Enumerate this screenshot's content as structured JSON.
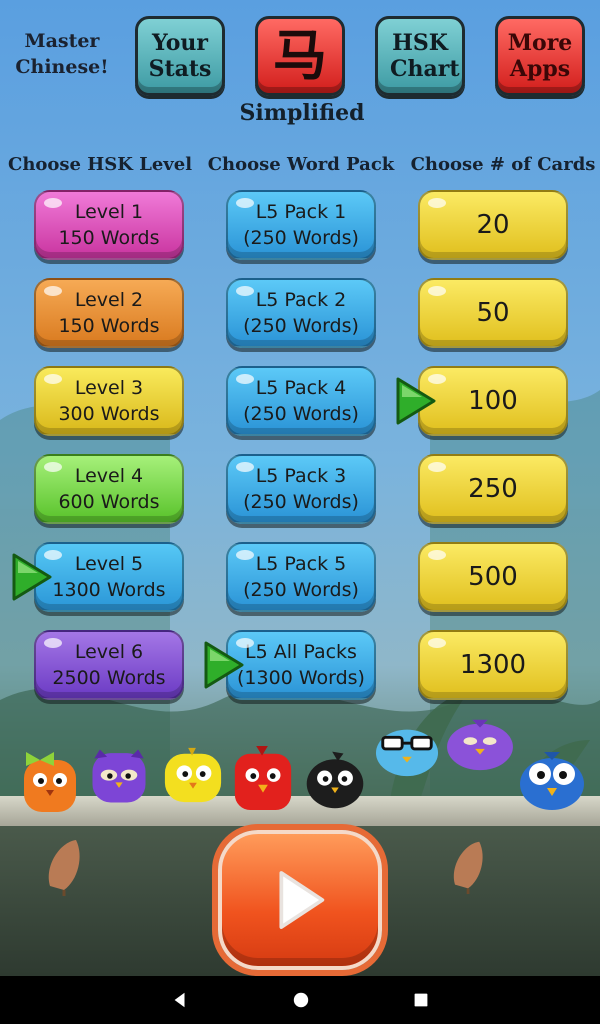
{
  "header": {
    "app_title": "Master Chinese!",
    "stats_label": "Your Stats",
    "char_button": "马",
    "hsk_chart_label": "HSK Chart",
    "more_apps_label": "More Apps",
    "script_mode": "Simplified"
  },
  "columns": {
    "levels_header": "Choose HSK Level",
    "packs_header": "Choose Word Pack",
    "cards_header": "Choose # of Cards"
  },
  "levels": [
    {
      "name": "Level 1",
      "words": "150 Words",
      "color": "#d94fba"
    },
    {
      "name": "Level 2",
      "words": "150 Words",
      "color": "#e8902f"
    },
    {
      "name": "Level 3",
      "words": "300 Words",
      "color": "#ecd32a"
    },
    {
      "name": "Level 4",
      "words": "600 Words",
      "color": "#72d43d"
    },
    {
      "name": "Level 5",
      "words": "1300 Words",
      "color": "#3aa9e3",
      "selected": true
    },
    {
      "name": "Level 6",
      "words": "2500 Words",
      "color": "#8552d3"
    }
  ],
  "packs": [
    {
      "name": "L5 Pack 1",
      "words": "(250 Words)"
    },
    {
      "name": "L5 Pack 2",
      "words": "(250 Words)"
    },
    {
      "name": "L5 Pack 4",
      "words": "(250 Words)"
    },
    {
      "name": "L5 Pack 3",
      "words": "(250 Words)"
    },
    {
      "name": "L5 Pack 5",
      "words": "(250 Words)"
    },
    {
      "name": "L5 All Packs",
      "words": "(1300 Words)",
      "selected": true
    }
  ],
  "cards": [
    {
      "count": "20"
    },
    {
      "count": "50"
    },
    {
      "count": "100",
      "selected": true
    },
    {
      "count": "250"
    },
    {
      "count": "500"
    },
    {
      "count": "1300"
    }
  ],
  "icons": {
    "selection_marker": "green-triangle-arrow-icon",
    "play": "play-icon",
    "nav_back": "back-icon",
    "nav_home": "home-icon",
    "nav_recents": "recents-icon"
  },
  "colors": {
    "top_button_teal": "#3d9aa3",
    "top_button_red": "#d21e1c",
    "pack_blue": "#2a93d6",
    "card_yellow": "#e0bf1d",
    "play_orange": "#f0531e",
    "selection_green": "#2fae2a"
  }
}
